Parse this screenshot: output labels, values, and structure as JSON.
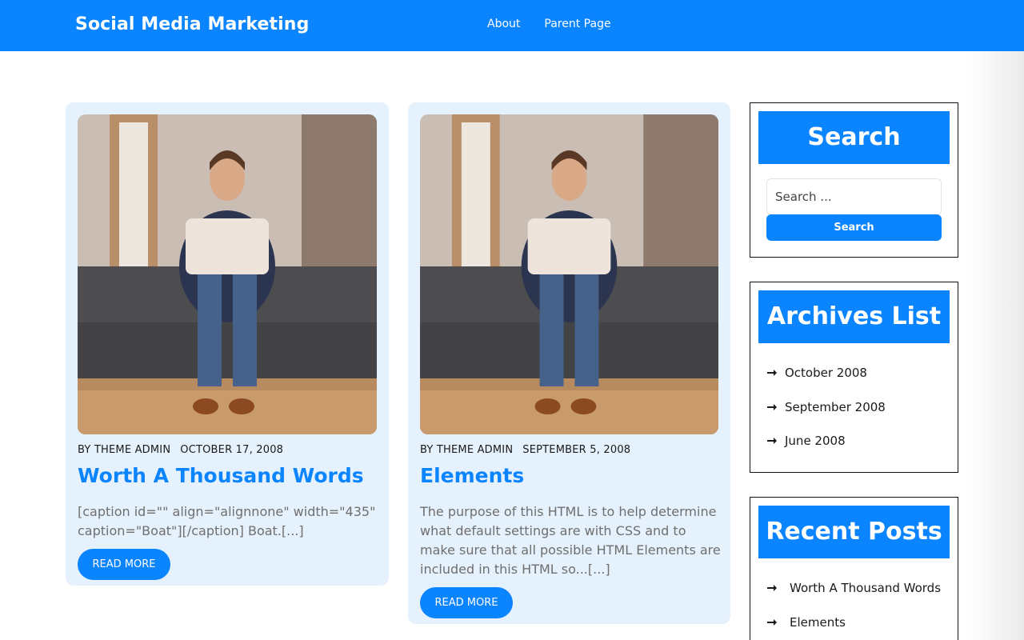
{
  "header": {
    "site_title": "Social Media Marketing",
    "nav": [
      {
        "label": "About"
      },
      {
        "label": "Parent Page"
      }
    ]
  },
  "posts": [
    {
      "author": "BY THEME ADMIN",
      "date": "OCTOBER 17, 2008",
      "title": "Worth A Thousand Words",
      "excerpt": "[caption id=\"\" align=\"alignnone\" width=\"435\" caption=\"Boat\"][/caption] Boat.[...]",
      "read_more": "READ MORE"
    },
    {
      "author": "BY THEME ADMIN",
      "date": "SEPTEMBER 5, 2008",
      "title": "Elements",
      "excerpt": "The purpose of this HTML is to help determine what default settings are with CSS and to make sure that all possible HTML Elements are included in this HTML so...[...]",
      "read_more": "READ MORE"
    }
  ],
  "sidebar": {
    "search": {
      "title": "Search",
      "placeholder": "Search ...",
      "button_label": "Search"
    },
    "archives": {
      "title": "Archives List",
      "items": [
        "October 2008",
        "September 2008",
        "June 2008"
      ]
    },
    "recent": {
      "title": "Recent Posts",
      "items": [
        "Worth A Thousand Words",
        "Elements"
      ]
    }
  },
  "icons": {
    "list_bullet": "arrow-right-icon"
  },
  "colors": {
    "brand": "#0a84ff",
    "card_bg": "#e5f1fd"
  }
}
